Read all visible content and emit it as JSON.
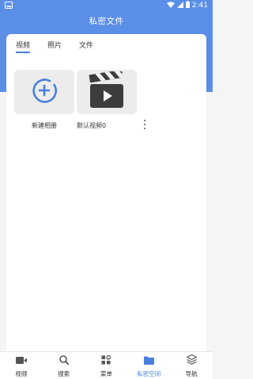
{
  "status_bar": {
    "time": "2:41"
  },
  "header": {
    "title": "私密文件"
  },
  "tabs": [
    {
      "label": "视频",
      "active": true
    },
    {
      "label": "照片",
      "active": false
    },
    {
      "label": "文件",
      "active": false
    }
  ],
  "albums": [
    {
      "label": "新建相册",
      "icon": "add-circle-icon"
    },
    {
      "label": "默认视频0",
      "icon": "clapperboard-icon"
    }
  ],
  "bottom_nav": [
    {
      "label": "视频",
      "icon": "video-icon",
      "active": false
    },
    {
      "label": "搜索",
      "icon": "search-icon",
      "active": false
    },
    {
      "label": "菜单",
      "icon": "grid-menu-icon",
      "active": false
    },
    {
      "label": "私密空间",
      "icon": "folder-icon",
      "active": true
    },
    {
      "label": "导航",
      "icon": "layers-icon",
      "active": false
    }
  ],
  "colors": {
    "accent": "#4a7fdd",
    "header": "#5b8ee6"
  }
}
